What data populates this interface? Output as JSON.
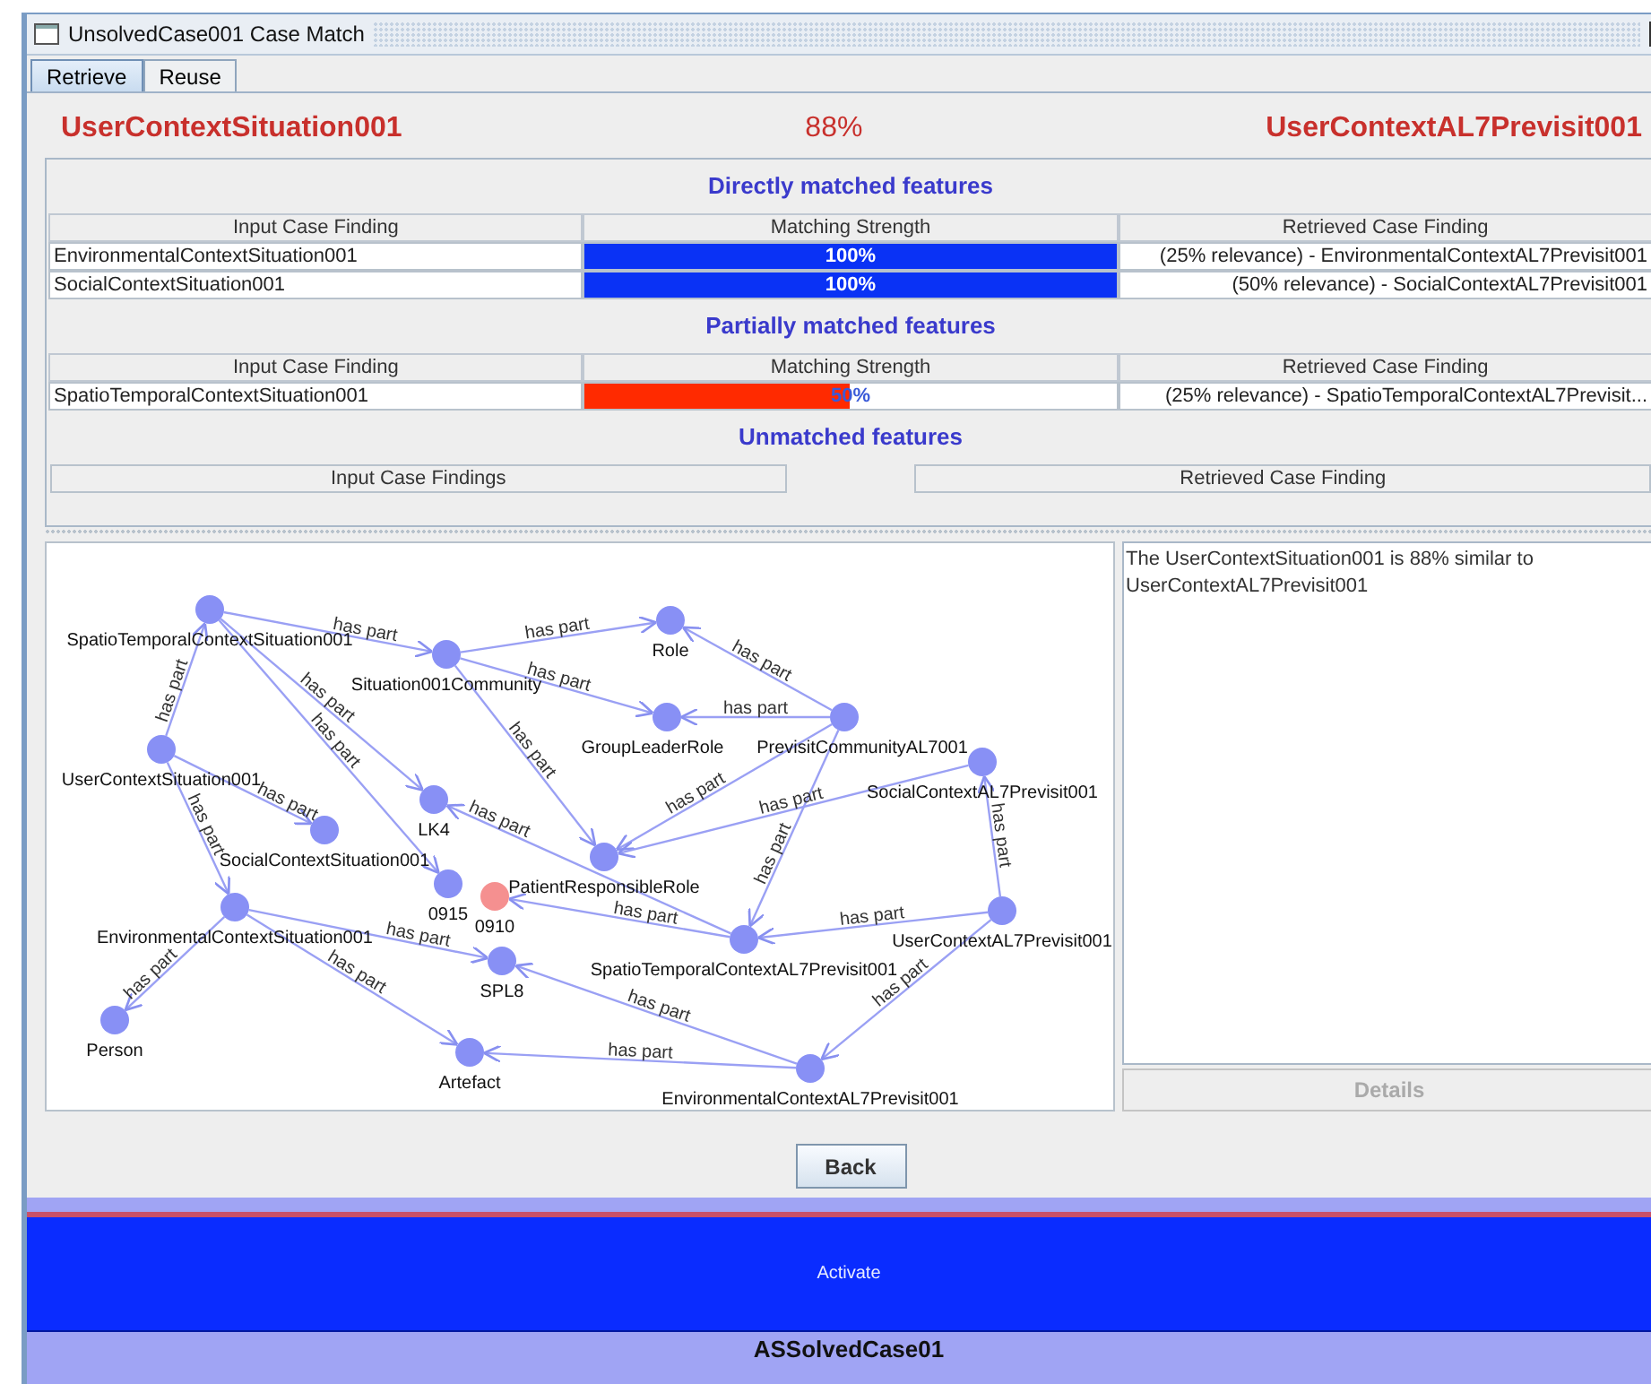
{
  "window": {
    "title": "UnsolvedCase001 Case Match"
  },
  "tabs": [
    {
      "label": "Retrieve",
      "selected": true
    },
    {
      "label": "Reuse",
      "selected": false
    }
  ],
  "header": {
    "input_case": "UserContextSituation001",
    "similarity": "88%",
    "retrieved_case": "UserContextAL7Previsit001"
  },
  "sections": [
    {
      "title": "Directly matched features",
      "columns": [
        "Input Case Finding",
        "Matching Strength",
        "Retrieved Case Finding"
      ],
      "rows": [
        {
          "input": "EnvironmentalContextSituation001",
          "strength": "100%",
          "level": 1,
          "color": "#0a32f5",
          "retrieved": "(25% relevance) - EnvironmentalContextAL7Previsit001"
        },
        {
          "input": "SocialContextSituation001",
          "strength": "100%",
          "level": 1,
          "color": "#0a32f5",
          "retrieved": "(50% relevance) - SocialContextAL7Previsit001"
        }
      ]
    },
    {
      "title": "Partially matched features",
      "columns": [
        "Input Case Finding",
        "Matching Strength",
        "Retrieved Case Finding"
      ],
      "rows": [
        {
          "input": "SpatioTemporalContextSituation001",
          "strength": "50%",
          "level": 0.5,
          "color": "#ff2a00",
          "retrieved": "(25% relevance) - SpatioTemporalContextAL7Previsit..."
        }
      ]
    }
  ],
  "unmatched": {
    "title": "Unmatched features",
    "buttons": [
      "Input Case Findings",
      "Retrieved Case Finding"
    ]
  },
  "graph": {
    "nodes": [
      {
        "label": "SpatioTemporalContextSituation001",
        "highlighted": false
      },
      {
        "label": "Situation001Community",
        "highlighted": false
      },
      {
        "label": "Role",
        "highlighted": false
      },
      {
        "label": "GroupLeaderRole",
        "highlighted": false
      },
      {
        "label": "PrevisitCommunityAL7001",
        "highlighted": false
      },
      {
        "label": "UserContextSituation001",
        "highlighted": false
      },
      {
        "label": "LK4",
        "highlighted": false
      },
      {
        "label": "SocialContextSituation001",
        "highlighted": false
      },
      {
        "label": "0915",
        "highlighted": false
      },
      {
        "label": "0910",
        "highlighted": true
      },
      {
        "label": "PatientResponsibleRole",
        "highlighted": false
      },
      {
        "label": "SocialContextAL7Previsit001",
        "highlighted": false
      },
      {
        "label": "EnvironmentalContextSituation001",
        "highlighted": false
      },
      {
        "label": "SPL8",
        "highlighted": false
      },
      {
        "label": "SpatioTemporalContextAL7Previsit001",
        "highlighted": false
      },
      {
        "label": "UserContextAL7Previsit001",
        "highlighted": false
      },
      {
        "label": "Person",
        "highlighted": false
      },
      {
        "label": "Artefact",
        "highlighted": false
      },
      {
        "label": "EnvironmentalContextAL7Previsit001",
        "highlighted": false
      }
    ],
    "edges": [
      {
        "label": "has part"
      },
      {
        "label": "has part"
      },
      {
        "label": "has part"
      },
      {
        "label": "has part"
      },
      {
        "label": "has part"
      },
      {
        "label": "has part"
      },
      {
        "label": "has part"
      },
      {
        "label": "has part"
      },
      {
        "label": "has part"
      },
      {
        "label": "has part"
      },
      {
        "label": "has part"
      },
      {
        "label": "has part"
      },
      {
        "label": "has part"
      },
      {
        "label": "has part"
      },
      {
        "label": "has part"
      },
      {
        "label": "has part"
      },
      {
        "label": "has part"
      },
      {
        "label": "has part"
      },
      {
        "label": "has part"
      },
      {
        "label": "has part"
      },
      {
        "label": "has part"
      },
      {
        "label": "has part"
      },
      {
        "label": "has part"
      },
      {
        "label": "has part"
      }
    ]
  },
  "description": "The UserContextSituation001 is 88% similar to UserContextAL7Previsit001",
  "details_button": {
    "label": "Details",
    "disabled": true
  },
  "back_button": "Back",
  "activate_button": "Activate",
  "footer": "ASSolvedCase01"
}
